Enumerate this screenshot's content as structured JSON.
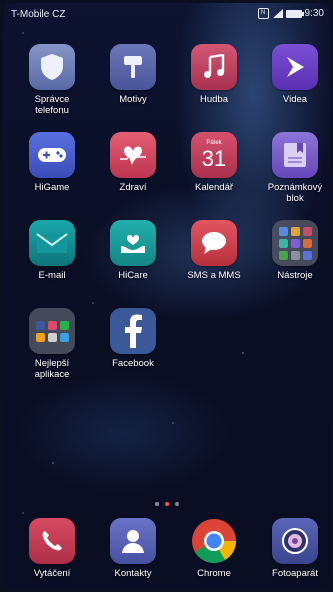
{
  "status_bar": {
    "carrier": "T-Mobile CZ",
    "time": "9:30",
    "nfc": "N",
    "icons": [
      "nfc-icon",
      "signal-icon",
      "battery-icon"
    ]
  },
  "apps": [
    {
      "label": "Správce\ntelefonu",
      "icon": "shield-icon",
      "color": "#6f7fb4"
    },
    {
      "label": "Motivy",
      "icon": "paintbrush-icon",
      "color": "#5b68a8"
    },
    {
      "label": "Hudba",
      "icon": "music-note-icon",
      "color": "#c0405f"
    },
    {
      "label": "Videa",
      "icon": "play-icon",
      "color": "#6a3fc6"
    },
    {
      "label": "HiGame",
      "icon": "gamepad-icon",
      "color": "#4a5fd1"
    },
    {
      "label": "Zdraví",
      "icon": "heart-icon",
      "color": "#d94a62"
    },
    {
      "label": "Kalendář",
      "icon": "calendar-icon",
      "color": "#c5435f",
      "calendar_day": "31",
      "calendar_weekday": "Pátek"
    },
    {
      "label": "Poznámkový\nblok",
      "icon": "notepad-icon",
      "color": "#7a5fc9"
    },
    {
      "label": "E-mail",
      "icon": "envelope-icon",
      "color": "#138e92"
    },
    {
      "label": "HiCare",
      "icon": "hand-heart-icon",
      "color": "#18a0a0"
    },
    {
      "label": "SMS a MMS",
      "icon": "chat-bubble-icon",
      "color": "#d9454e"
    },
    {
      "label": "Nástroje",
      "icon": "folder-icon",
      "color": "#4b5060"
    },
    {
      "label": "Nejlepší\naplikace",
      "icon": "folder-icon",
      "color": "#4b5060"
    },
    {
      "label": "Facebook",
      "icon": "facebook-icon",
      "color": "#3b5998"
    }
  ],
  "pager": {
    "count": 3,
    "active_index": 1
  },
  "dock": [
    {
      "label": "Vytáčení",
      "icon": "phone-icon",
      "color": "#c73c55"
    },
    {
      "label": "Kontakty",
      "icon": "contacts-icon",
      "color": "#5a64b6"
    },
    {
      "label": "Chrome",
      "icon": "chrome-icon",
      "color": "#ffffff"
    },
    {
      "label": "Fotoaparát",
      "icon": "camera-icon",
      "color": "#4a57a8"
    }
  ]
}
